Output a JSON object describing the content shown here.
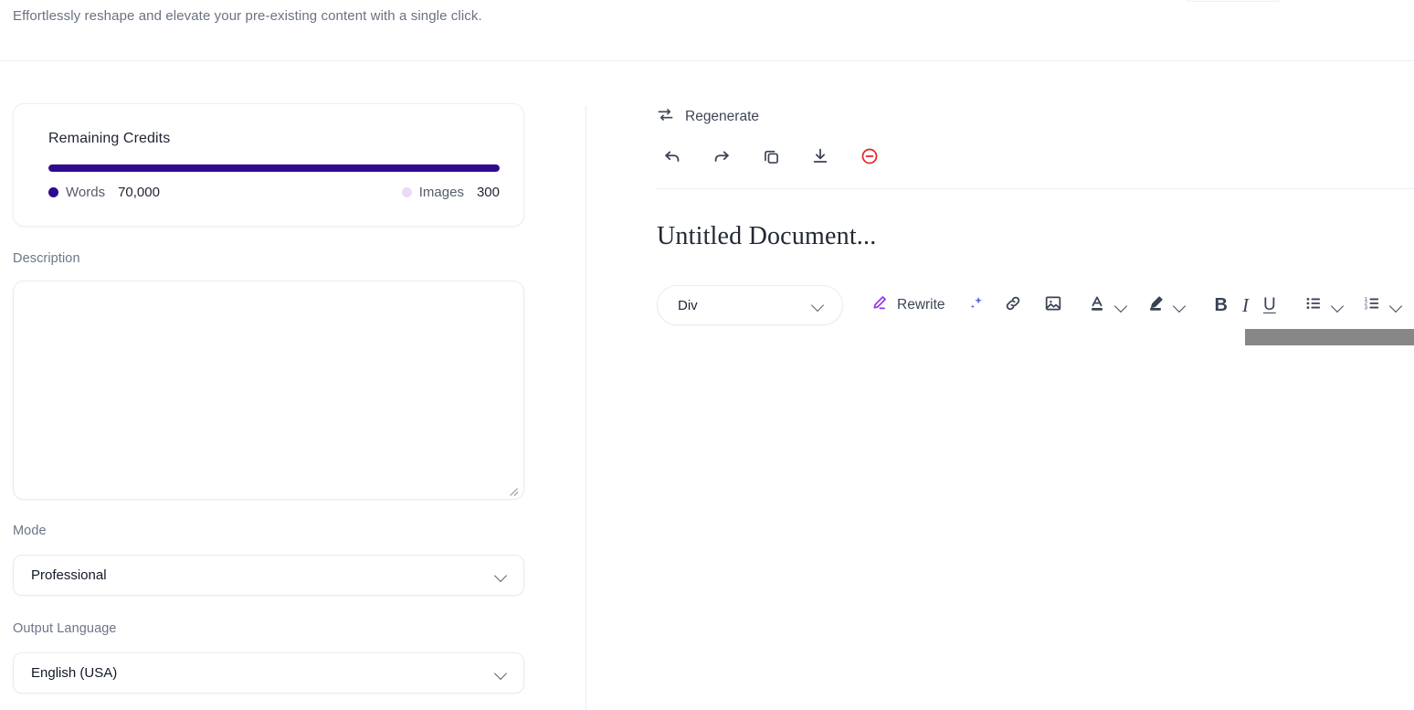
{
  "header": {
    "subtitle": "Effortlessly reshape and elevate your pre-existing content with a single click."
  },
  "colors": {
    "accent_purple": "#2e0a8f",
    "images_dot": "#ecd9f7",
    "rewrite_purple": "#9333ea",
    "delete_red": "#e3242b",
    "sparkle_blue": "#6366f1",
    "icon_dark": "#3a4254",
    "scrollbar_thumb": "#878787"
  },
  "credits": {
    "title": "Remaining Credits",
    "progress_percent": 100,
    "legend": [
      {
        "label": "Words",
        "value": "70,000",
        "dot": "words-dot"
      },
      {
        "label": "Images",
        "value": "300",
        "dot": "images-dot"
      }
    ]
  },
  "form": {
    "description": {
      "label": "Description",
      "value": "",
      "placeholder": ""
    },
    "mode": {
      "label": "Mode",
      "value": "Professional",
      "chevron": "chevron-down-icon"
    },
    "output_language": {
      "label": "Output Language",
      "value": "English (USA)",
      "chevron": "chevron-down-icon"
    }
  },
  "editor": {
    "regenerate": {
      "label": "Regenerate",
      "icon": "regenerate-icon"
    },
    "actions": [
      {
        "name": "undo-button",
        "icon": "undo-icon"
      },
      {
        "name": "redo-button",
        "icon": "redo-icon"
      },
      {
        "name": "copy-button",
        "icon": "copy-icon"
      },
      {
        "name": "download-button",
        "icon": "download-icon"
      },
      {
        "name": "delete-button",
        "icon": "minus-circle-icon"
      }
    ],
    "document_title": "Untitled Document...",
    "toolbar": {
      "block_format": {
        "value": "Div",
        "chevron": "chevron-down-icon"
      },
      "rewrite": {
        "label": "Rewrite",
        "icon": "pencil-icon"
      },
      "items": [
        {
          "name": "ai-sparkle-button",
          "icon": "sparkle-icon"
        },
        {
          "name": "insert-link-button",
          "icon": "link-icon"
        },
        {
          "name": "insert-image-button",
          "icon": "image-icon"
        },
        {
          "name": "text-color-button",
          "icon": "text-color-icon"
        },
        {
          "name": "highlight-color-button",
          "icon": "highlighter-icon"
        },
        {
          "name": "bold-button",
          "icon": "bold-icon",
          "glyph": "B"
        },
        {
          "name": "italic-button",
          "icon": "italic-icon",
          "glyph": "I"
        },
        {
          "name": "underline-button",
          "icon": "underline-icon",
          "glyph": "U"
        },
        {
          "name": "bullet-list-button",
          "icon": "bullet-list-icon"
        },
        {
          "name": "numbered-list-button",
          "icon": "numbered-list-icon"
        }
      ]
    },
    "scrollbar": {
      "orientation": "horizontal",
      "thumb_fraction": 0.83
    }
  }
}
